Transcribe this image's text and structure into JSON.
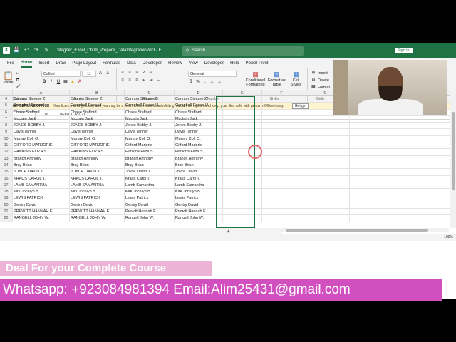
{
  "title_bar": {
    "autosave_icon": "save-icon",
    "doc_title": "Stagner_Excel_Ch09_Prepare_DataIntegration2of3 - E...",
    "search_placeholder": "Search",
    "sign_in": "Sign in"
  },
  "tabs": [
    "File",
    "Home",
    "Insert",
    "Draw",
    "Page Layout",
    "Formulas",
    "Data",
    "Developer",
    "Review",
    "View",
    "Developer",
    "Help",
    "Power Pivot"
  ],
  "active_tab": "Home",
  "ribbon": {
    "paste": "Paste",
    "clipboard": "Clipboard",
    "font_name": "Calibri",
    "font_size": "11",
    "font": "Font",
    "alignment": "Alignment",
    "number_format": "General",
    "number": "Number",
    "conditional_formatting": "Conditional Formatting",
    "format_as_table": "Format as Table",
    "cell_styles": "Cell Styles",
    "styles": "Styles",
    "insert": "Insert",
    "delete": "Delete",
    "format": "Format",
    "cells": "Cells"
  },
  "warning": {
    "title": "GET GENUINE OFFICE",
    "message": "Your license isn't genuine, and you may be a victim of software counterfeiting. Avoid interruption and keep your files safe with genuine Office today.",
    "button": "Get ge"
  },
  "formula_bar": {
    "name_box": "E2",
    "fx": "fx",
    "formula": "=FIND(D2,D2)"
  },
  "columns": [
    "A",
    "B",
    "C",
    "D",
    "E",
    "F",
    "G",
    "H",
    "I"
  ],
  "rows": [
    {
      "n": "4",
      "a": "Cannon Simone Z",
      "b": "Cannon Simone Z.",
      "c": "Cannon Simone Z",
      "d": "Cannon Simone Z."
    },
    {
      "n": "5",
      "a": "Campbell Reece H.",
      "b": "Campbell Reece H.",
      "c": "Campbell Reece H.",
      "d": "Campbell Reece H."
    },
    {
      "n": "6",
      "a": "Chase Stafford",
      "b": "Chase Stafford",
      "c": "Chase Stafford",
      "d": "Chase Stafford"
    },
    {
      "n": "7",
      "a": "Mcclain  Jack",
      "b": "Mcclain  Jack",
      "c": "Mcclain Jack",
      "d": "Mcclain Jack"
    },
    {
      "n": "8",
      "a": "JONES BOBBY J.",
      "b": "JONES BOBBY J.",
      "c": "Jones Bobby J.",
      "d": "Jones Bobby J."
    },
    {
      "n": "9",
      "a": "Davis Tanner",
      "b": "Davis Tanner",
      "c": "Davis Tanner",
      "d": "Davis Tanner"
    },
    {
      "n": "10",
      "a": "Murray Colt   Q.",
      "b": "Murray Colt   Q.",
      "c": "Murray Colt Q.",
      "d": "Murray Colt Q."
    },
    {
      "n": "11",
      "a": "GIFFORD  MARJORIE",
      "b": "GIFFORD  MARJORIE",
      "c": "Gifford  Marjorie",
      "d": "Gifford Marjorie"
    },
    {
      "n": "12",
      "a": "HANKINS   ELIZA S.",
      "b": "HANKINS   ELIZA S.",
      "c": "Hankins   Eliza S.",
      "d": "Hankins Eliza S."
    },
    {
      "n": "13",
      "a": "Branch  Anthony",
      "b": "Branch  Anthony",
      "c": "Branch  Anthony",
      "d": "Branch Anthony"
    },
    {
      "n": "14",
      "a": "Bray Brian",
      "b": "Bray Brian",
      "c": "Bray Brian",
      "d": "Bray Brian"
    },
    {
      "n": "15",
      "a": "JOYCE DAVID J.",
      "b": "JOYCE DAVID J.",
      "c": "Joyce David J.",
      "d": "Joyce David J."
    },
    {
      "n": "16",
      "a": "KRAUS   CAROL T.",
      "b": "KRAUS   CAROL T.",
      "c": "Kraus   Carol T.",
      "d": "Kraus Carol T."
    },
    {
      "n": "17",
      "a": "LAMB SAMANTHA",
      "b": "LAMB SAMANTHA",
      "c": "Lamb Samantha",
      "d": "Lamb Samantha"
    },
    {
      "n": "18",
      "a": "Kirk Jocelyn B.",
      "b": "Kirk Jocelyn B.",
      "c": "Kirk Jocelyn B.",
      "d": "Kirk Jocelyn B."
    },
    {
      "n": "19",
      "a": "LEWIS       PATRICK",
      "b": "LEWIS       PATRICK",
      "c": "Lewis       Patrick",
      "d": "Lewis Patrick"
    },
    {
      "n": "20",
      "a": "Gentry David",
      "b": "Gentry David",
      "c": "Gentry David",
      "d": "Gentry David"
    },
    {
      "n": "21",
      "a": "PREWITT   HANNAH E.",
      "b": "PREWITT   HANNAH E.",
      "c": "Prewitt   Hannah E.",
      "d": "Prewitt Hannah E."
    },
    {
      "n": "22",
      "a": "RANGELL  JOHN W.",
      "b": "RANGELL  JOHN W.",
      "c": "Rangell  John W.",
      "d": "Rangell John W."
    }
  ],
  "status": {
    "zoom": "100%"
  },
  "overlay": {
    "deal": "Deal For your Complete Course",
    "contact": "Whatsapp: +923084981394 Email:Alim25431@gmail.com"
  }
}
